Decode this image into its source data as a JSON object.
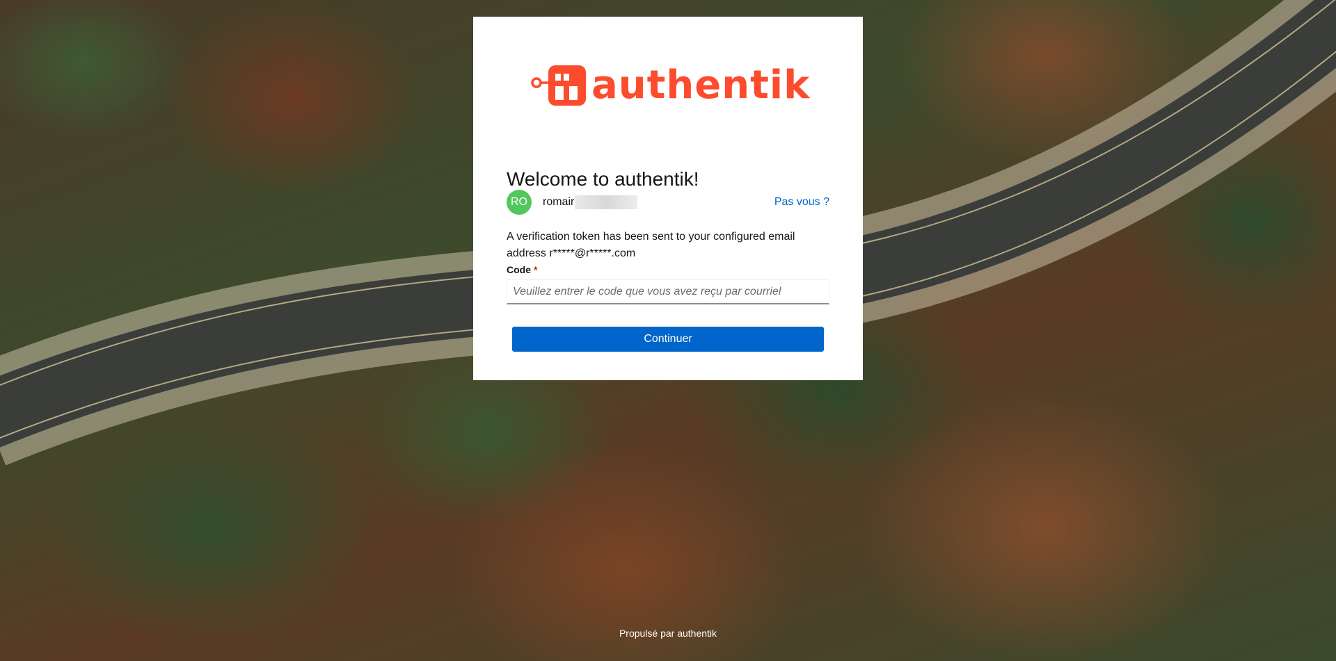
{
  "app": {
    "brand_name": "authentik",
    "brand_color": "#fd4b2d"
  },
  "background": {
    "description_icon": "forest-road-aerial-image"
  },
  "card": {
    "title": "Welcome to authentik!",
    "user": {
      "avatar_initials": "RO",
      "avatar_color": "#52c75b",
      "username_visible": "romair"
    },
    "not_you_label": "Pas vous ?",
    "info_text": "A verification token has been sent to your configured email address r*****@r*****.com",
    "code_field": {
      "label": "Code",
      "required_marker": "*",
      "placeholder": "Veuillez entrer le code que vous avez reçu par courriel",
      "value": ""
    },
    "continue_label": "Continuer",
    "accent_color": "#0066cc"
  },
  "footer": {
    "text": "Propulsé par authentik"
  }
}
